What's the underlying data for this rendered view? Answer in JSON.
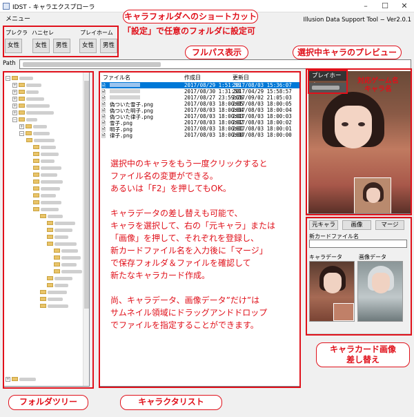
{
  "window": {
    "title": "IDST - キャラエクスプローラ",
    "menu_label": "メニュー",
    "version": "Illusion Data Support Tool − Ver2.0.1"
  },
  "shortcuts": {
    "groups": [
      {
        "label": "プレクラ",
        "buttons": [
          "女性"
        ]
      },
      {
        "label": "ハニセレ",
        "buttons": [
          "女性",
          "男性"
        ]
      },
      {
        "label": "プレイホーム",
        "buttons": [
          "女性",
          "男性"
        ]
      }
    ]
  },
  "path": {
    "label": "Path"
  },
  "file_list": {
    "columns": [
      "ファイル名",
      "作成日",
      "更新日"
    ],
    "rows": [
      {
        "name": "",
        "created": "2017/08/29 1:51:36",
        "modified": "2017/08/03 15:36:07",
        "selected": true
      },
      {
        "name": "",
        "created": "2017/08/30 1:31:58",
        "modified": "2017/04/29 15:58:57",
        "selected": false
      },
      {
        "name": "",
        "created": "2017/08/27 23:59:26",
        "modified": "2017/09/02 21:05:03",
        "selected": false
      },
      {
        "name": "偽ついた雪子.png",
        "created": "2017/08/03 18:00:05",
        "modified": "2017/08/03 18:00:05",
        "selected": false
      },
      {
        "name": "偽ついた明子.png",
        "created": "2017/08/03 18:00:04",
        "modified": "2017/08/03 18:00:04",
        "selected": false
      },
      {
        "name": "偽ついた律子.png",
        "created": "2017/08/03 18:00:03",
        "modified": "2017/08/03 18:00:03",
        "selected": false
      },
      {
        "name": "雪子.png",
        "created": "2017/08/03 18:00:02",
        "modified": "2017/08/03 18:00:02",
        "selected": false
      },
      {
        "name": "明子.png",
        "created": "2017/08/03 18:00:01",
        "modified": "2017/08/03 18:00:01",
        "selected": false
      },
      {
        "name": "律子.png",
        "created": "2017/08/03 18:00:00",
        "modified": "2017/08/03 18:00:00",
        "selected": false
      }
    ]
  },
  "preview": {
    "game_tag": "プレイホーム"
  },
  "card_replace": {
    "buttons": [
      "元キャラ",
      "画像",
      "マージ"
    ],
    "new_file_label": "新カードファイル名",
    "char_data_label": "キャラデータ",
    "image_data_label": "画像データ"
  },
  "annotations": {
    "shortcut_title": "キャラフォルダへのショートカット",
    "shortcut_sub": "「設定」で任意のフォルダに設定可",
    "fullpath": "フルパス表示",
    "preview_title": "選択中キャラのプレビュー",
    "game_char": "対応ゲーム名\nキャラ名",
    "folder_tree": "フォルダツリー",
    "char_list": "キャラクタリスト",
    "card_replace_title": "キャラカード画像\n差し替え",
    "instructions": [
      "選択中のキャラをもう一度クリックすると\nファイル名の変更ができる。\nあるいは「F2」を押してもOK。",
      "キャラデータの差し替えも可能で、\nキャラを選択して、右の「元キャラ」または\n「画像」を押して、それぞれを登録し、\n新カードファイル名を入力後に「マージ」\nで保存フォルダ＆ファイルを確認して\n新たなキャラカード作成。",
      "尚、キャラデータ、画像データ”だけ”は\nサムネイル領域にドラッグアンドドロップ\nでファイルを指定することができます。"
    ]
  }
}
